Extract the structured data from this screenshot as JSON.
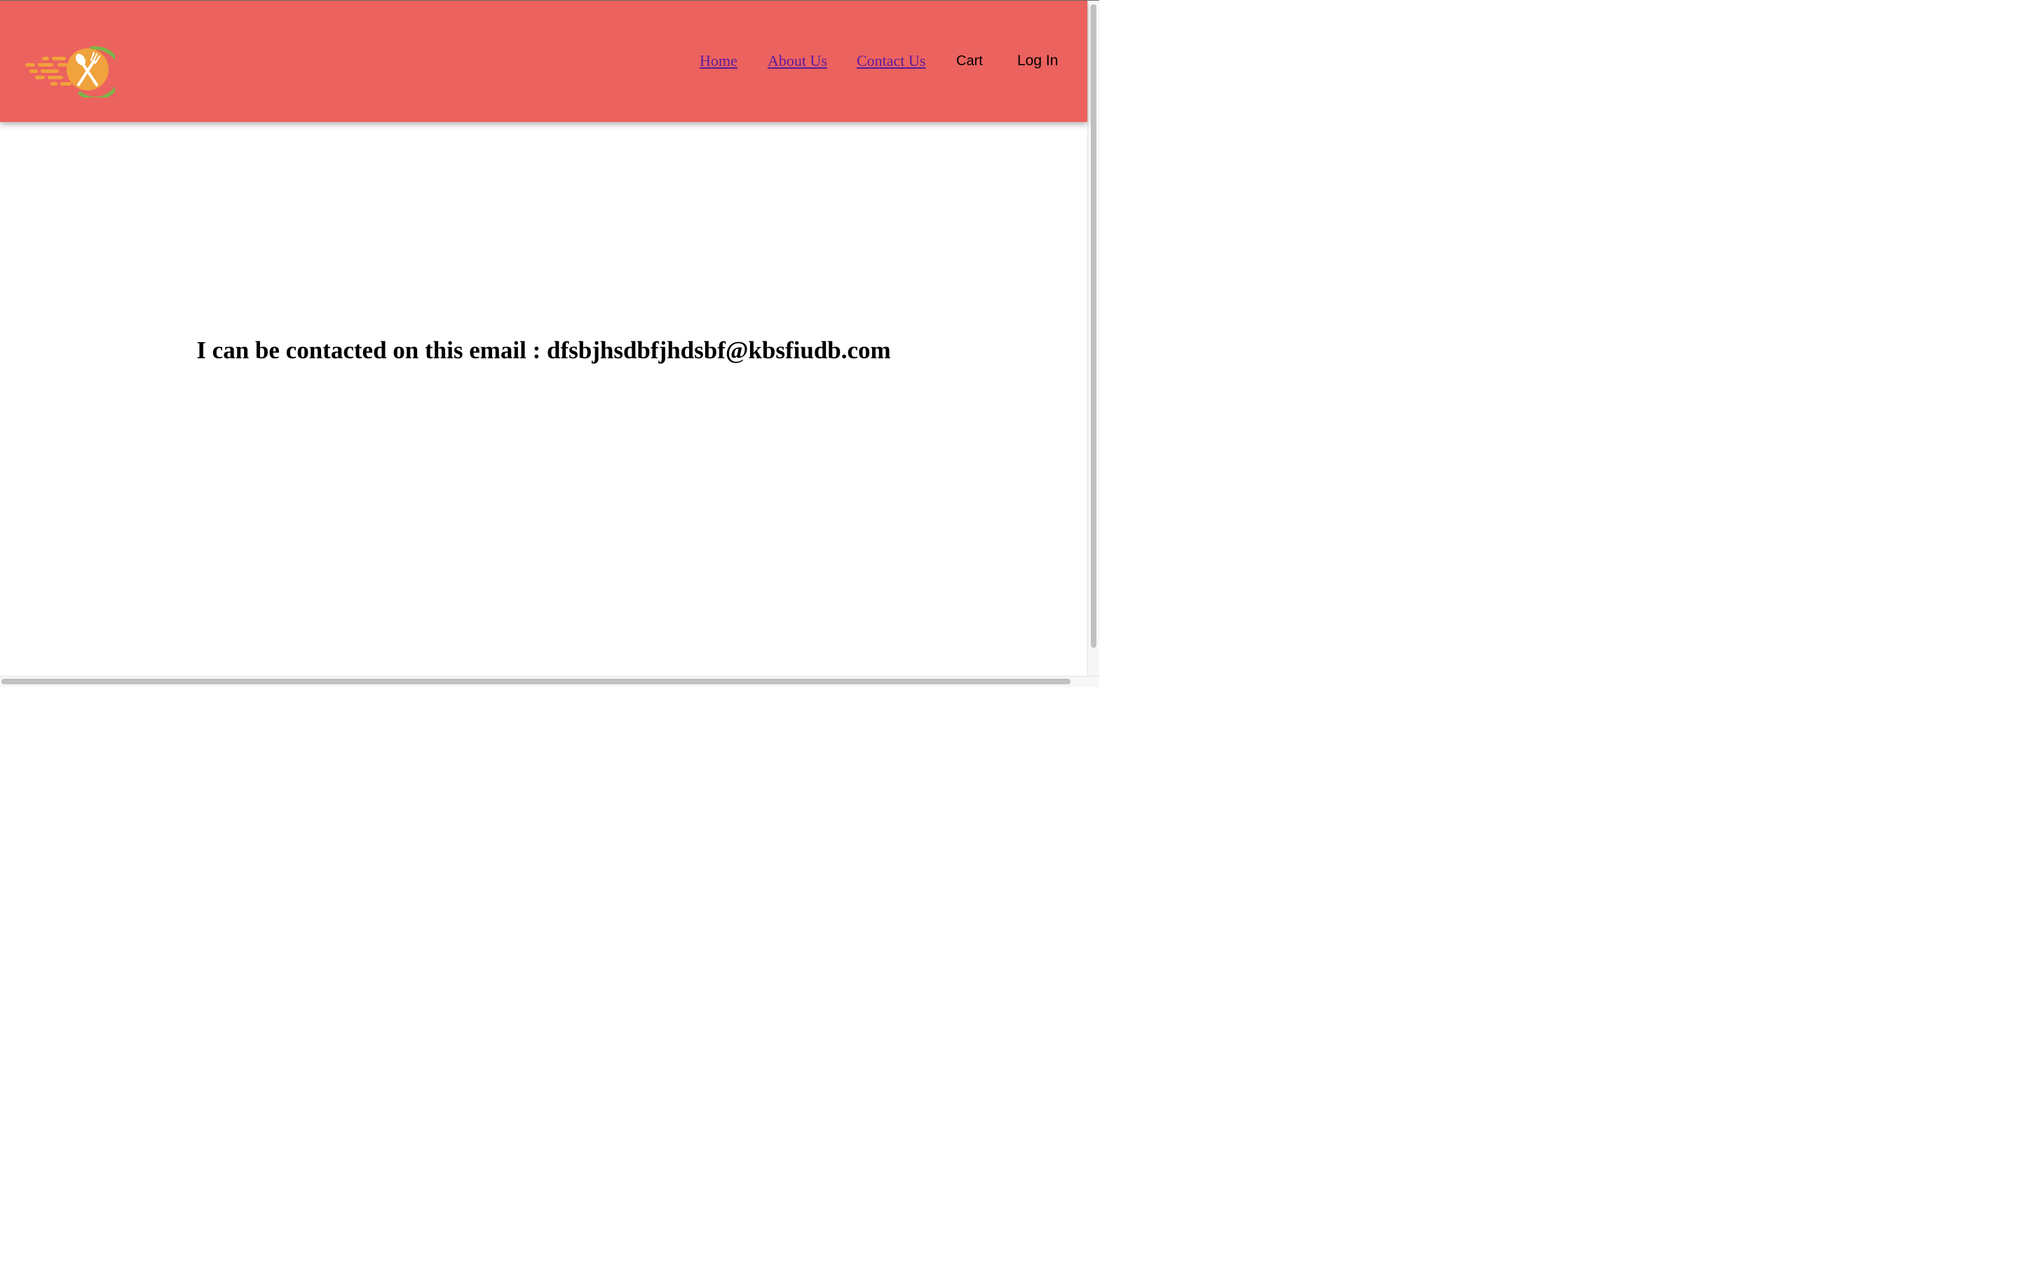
{
  "header": {
    "background_color": "#ec625e",
    "logo_icon": "food-delivery-logo-icon",
    "nav": {
      "home_label": "Home",
      "about_label": "About Us",
      "contact_label": "Contact Us",
      "cart_label": "Cart",
      "login_label": "Log In"
    }
  },
  "main": {
    "heading": "I can be contacted on this email : dfsbjhsdbfjhdsbf@kbsfiudb.com"
  },
  "colors": {
    "link_visited": "#5a1aa0",
    "logo_orange": "#f0a23c",
    "logo_green": "#7ab648"
  }
}
